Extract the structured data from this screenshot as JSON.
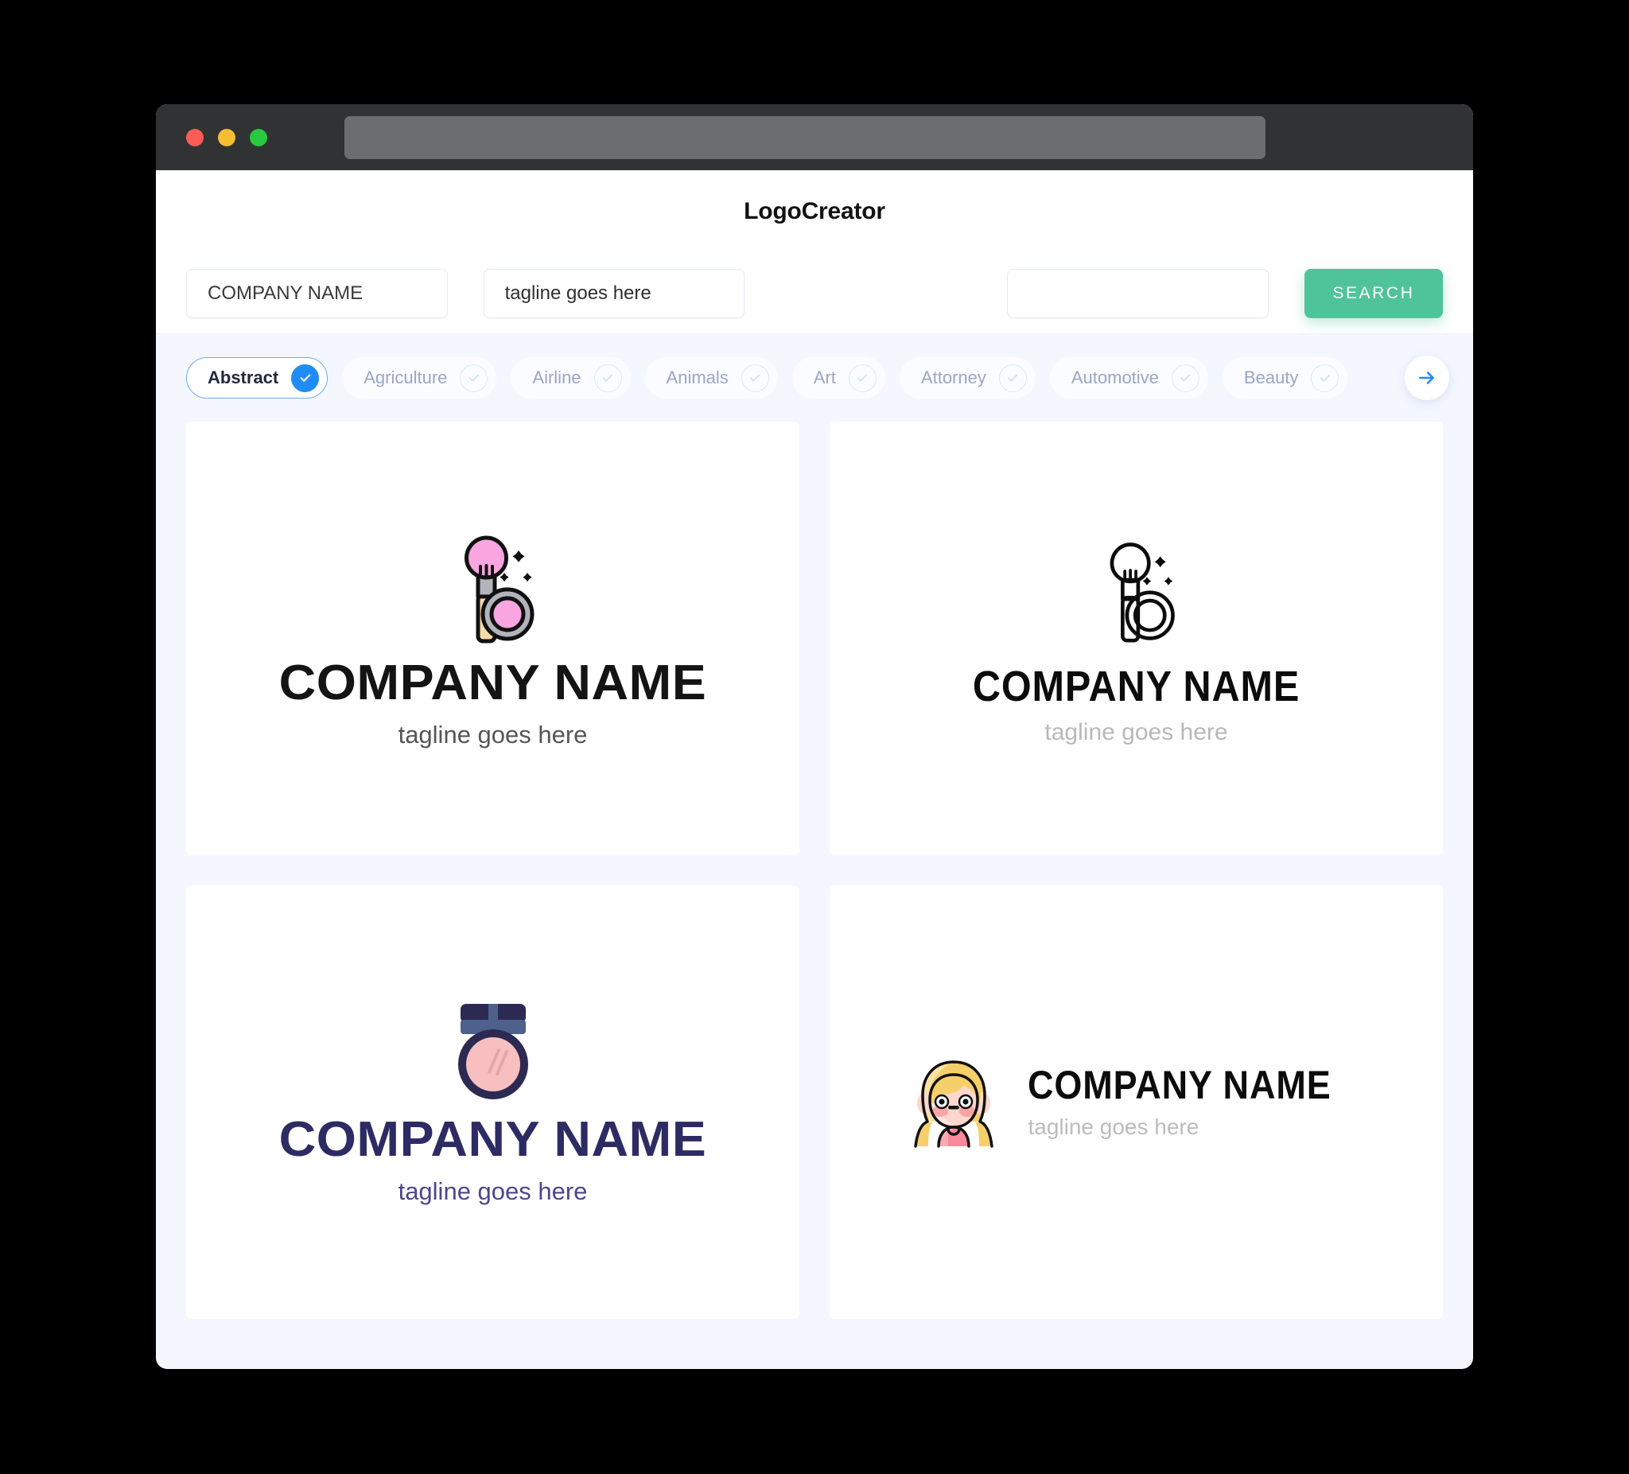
{
  "browser": {
    "traffic_lights": [
      "close-red",
      "minimize-yellow",
      "maximize-green"
    ],
    "url_value": ""
  },
  "header": {
    "title": "LogoCreator"
  },
  "search": {
    "company_value": "COMPANY NAME",
    "tagline_value": "tagline goes here",
    "extra_value": "",
    "search_label": "SEARCH"
  },
  "categories": {
    "next_icon": "arrow-right-icon",
    "items": [
      {
        "label": "Abstract",
        "selected": true
      },
      {
        "label": "Agriculture",
        "selected": false
      },
      {
        "label": "Airline",
        "selected": false
      },
      {
        "label": "Animals",
        "selected": false
      },
      {
        "label": "Art",
        "selected": false
      },
      {
        "label": "Attorney",
        "selected": false
      },
      {
        "label": "Automotive",
        "selected": false
      },
      {
        "label": "Beauty",
        "selected": false
      }
    ]
  },
  "results": [
    {
      "icon": "makeup-brush-compact-color-icon",
      "company": "COMPANY NAME",
      "tagline": "tagline goes here",
      "layout": "stacked",
      "name_color": "#141414",
      "tagline_color": "#555555"
    },
    {
      "icon": "makeup-brush-compact-outline-icon",
      "company": "COMPANY NAME",
      "tagline": "tagline goes here",
      "layout": "stacked",
      "name_color": "#0c0c0c",
      "tagline_color": "#b9b9b9"
    },
    {
      "icon": "powder-compact-navy-icon",
      "company": "COMPANY NAME",
      "tagline": "tagline goes here",
      "layout": "stacked",
      "name_color": "#2d2b63",
      "tagline_color": "#4b478c"
    },
    {
      "icon": "blonde-girl-avatar-icon",
      "company": "COMPANY NAME",
      "tagline": "tagline goes here",
      "layout": "horizontal",
      "name_color": "#0c0c0c",
      "tagline_color": "#bcbcbc"
    }
  ],
  "colors": {
    "accent_green": "#4fc39a",
    "accent_blue": "#1f8df5",
    "page_bg": "#f4f7fe",
    "titlebar": "#303234"
  }
}
